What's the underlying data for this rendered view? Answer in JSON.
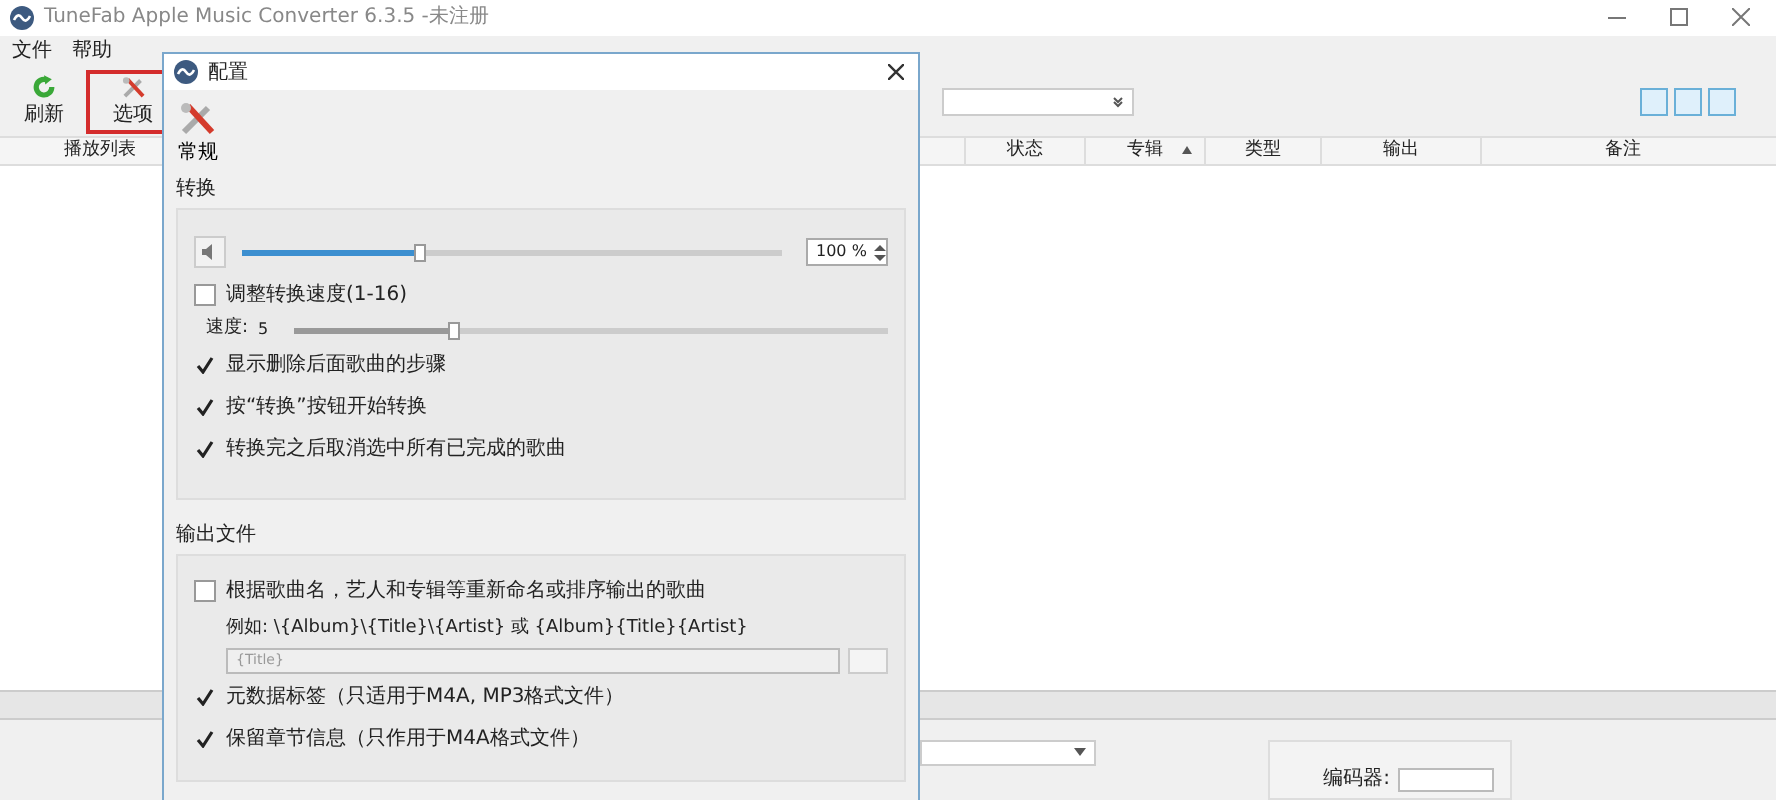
{
  "window": {
    "title": "TuneFab Apple Music Converter 6.3.5 -未注册"
  },
  "menu": [
    "文件",
    "帮助"
  ],
  "toolbar": [
    {
      "label": "刷新",
      "kind": "refresh",
      "highlighted": false
    },
    {
      "label": "选项",
      "kind": "options",
      "highlighted": true
    }
  ],
  "sidebar": {
    "title": "播放列表"
  },
  "table": {
    "columns": [
      {
        "label": "状态",
        "sorted": false
      },
      {
        "label": "专辑",
        "sorted": true
      },
      {
        "label": "类型",
        "sorted": false
      },
      {
        "label": "输出",
        "sorted": false
      },
      {
        "label": "备注",
        "sorted": false
      }
    ]
  },
  "bottom": {
    "encoder_label": "编码器:"
  },
  "dialog": {
    "title": "配置",
    "tabs": [
      {
        "label": "常规",
        "selected": true
      }
    ],
    "sections": [
      {
        "title": "转换",
        "items": [
          {
            "kind": "volume",
            "level": 0.33,
            "reading": "100 %"
          },
          {
            "kind": "checkbox",
            "label": "调整转换速度(1-16)",
            "checked": false
          },
          {
            "kind": "slider",
            "label": "速度:",
            "value": "5",
            "level": 0.27
          },
          {
            "kind": "checkbox",
            "label": "显示删除后面歌曲的步骤",
            "checked": true
          },
          {
            "kind": "checkbox",
            "label": "按“转换”按钮开始转换",
            "checked": true
          },
          {
            "kind": "checkbox",
            "label": "转换完之后取消选中所有已完成的歌曲",
            "checked": true
          }
        ]
      },
      {
        "title": "输出文件",
        "items": [
          {
            "kind": "checkbox",
            "label": "根据歌曲名，艺人和专辑等重新命名或排序输出的歌曲",
            "checked": false
          },
          {
            "kind": "note",
            "text": "例如: \\{Album}\\{Title}\\{Artist} 或 {Album}{Title}{Artist}"
          },
          {
            "kind": "input",
            "value": "{Title}",
            "disabled": true
          },
          {
            "kind": "checkbox",
            "label": "元数据标签（只适用于M4A, MP3格式文件）",
            "checked": true
          },
          {
            "kind": "checkbox",
            "label": "保留章节信息（只作用于M4A格式文件）",
            "checked": true
          }
        ]
      }
    ]
  }
}
